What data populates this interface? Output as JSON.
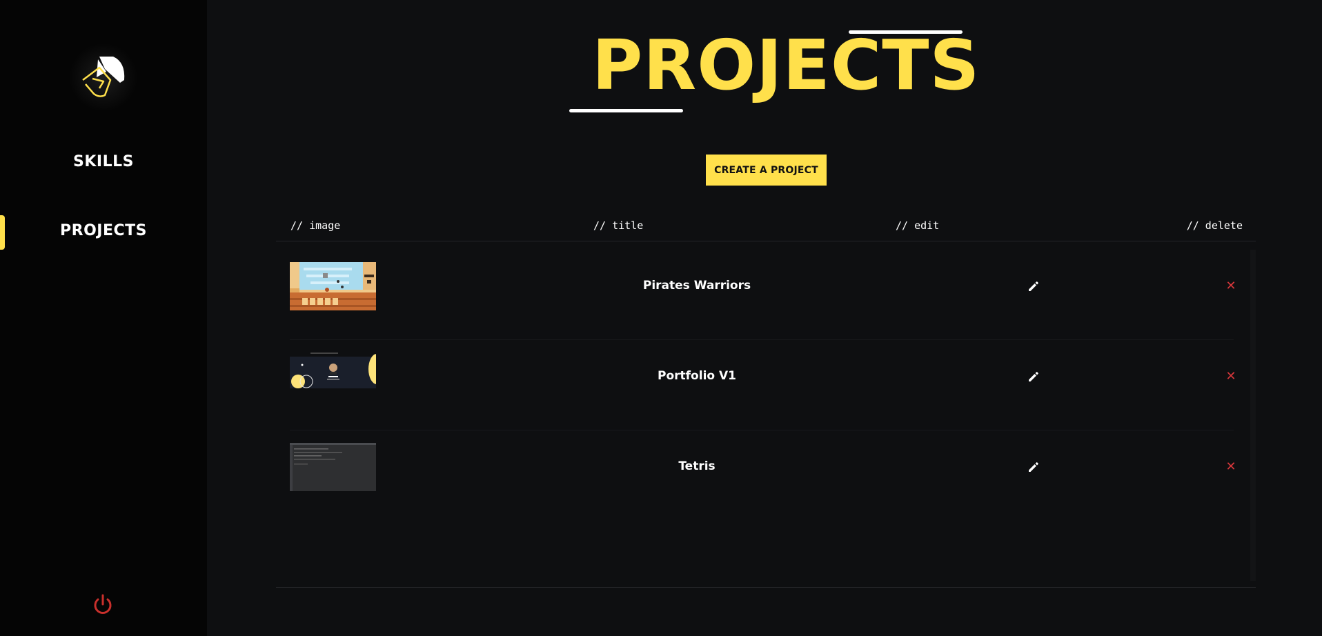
{
  "sidebar": {
    "items": [
      {
        "label": "SKILLS",
        "active": false
      },
      {
        "label": "PROJECTS",
        "active": true
      }
    ],
    "power_icon": "power-icon",
    "logo_icon": "brand-logo-icon"
  },
  "header": {
    "title": "PROJECTS"
  },
  "actions": {
    "create_label": "CREATE A PROJECT"
  },
  "table": {
    "columns": [
      "// image",
      "// title",
      "// edit",
      "// delete"
    ],
    "rows": [
      {
        "title": "Pirates Warriors",
        "thumbnail": "pirates-warriors-thumbnail",
        "edit_icon": "pencil-icon",
        "delete_icon": "close-icon"
      },
      {
        "title": "Portfolio V1",
        "thumbnail": "portfolio-v1-thumbnail",
        "edit_icon": "pencil-icon",
        "delete_icon": "close-icon"
      },
      {
        "title": "Tetris",
        "thumbnail": "tetris-thumbnail",
        "edit_icon": "pencil-icon",
        "delete_icon": "close-icon"
      }
    ],
    "delete_glyph": "✕"
  },
  "colors": {
    "accent": "#ffe04b",
    "background": "#0e0f11",
    "sidebar": "#050505",
    "danger": "#d8373b"
  }
}
